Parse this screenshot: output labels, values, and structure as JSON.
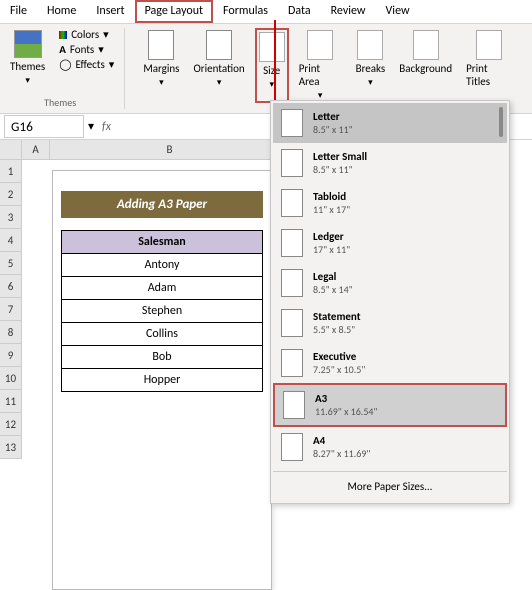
{
  "menubar": [
    "File",
    "Home",
    "Insert",
    "Page Layout",
    "Formulas",
    "Data",
    "Review",
    "View"
  ],
  "active_tab": "Page Layout",
  "ribbon": {
    "themes": {
      "label": "Themes",
      "group_label": "Themes",
      "colors": "Colors",
      "fonts": "Fonts",
      "effects": "Effects"
    },
    "page_setup": {
      "margins": "Margins",
      "orientation": "Orientation",
      "size": "Size",
      "print_area": "Print Area",
      "breaks": "Breaks",
      "background": "Background",
      "print_titles": "Print Titles"
    }
  },
  "namebox": "G16",
  "columns": [
    "",
    "A",
    "B"
  ],
  "rows": [
    "1",
    "2",
    "3",
    "4",
    "5",
    "6",
    "7",
    "8",
    "9",
    "10",
    "11",
    "12",
    "13"
  ],
  "sheet": {
    "title": "Adding A3 Paper",
    "header": "Salesman",
    "data": [
      "Antony",
      "Adam",
      "Stephen",
      "Collins",
      "Bob",
      "Hopper"
    ]
  },
  "size_dropdown": {
    "items": [
      {
        "name": "Letter",
        "dim": "8.5\" x 11\"",
        "selected": true
      },
      {
        "name": "Letter Small",
        "dim": "8.5\" x 11\""
      },
      {
        "name": "Tabloid",
        "dim": "11\" x 17\""
      },
      {
        "name": "Ledger",
        "dim": "17\" x 11\""
      },
      {
        "name": "Legal",
        "dim": "8.5\" x 14\""
      },
      {
        "name": "Statement",
        "dim": "5.5\" x 8.5\""
      },
      {
        "name": "Executive",
        "dim": "7.25\" x 10.5\""
      },
      {
        "name": "A3",
        "dim": "11.69\" x 16.54\"",
        "highlighted": true
      },
      {
        "name": "A4",
        "dim": "8.27\" x 11.69\""
      }
    ],
    "more": "More Paper Sizes..."
  }
}
